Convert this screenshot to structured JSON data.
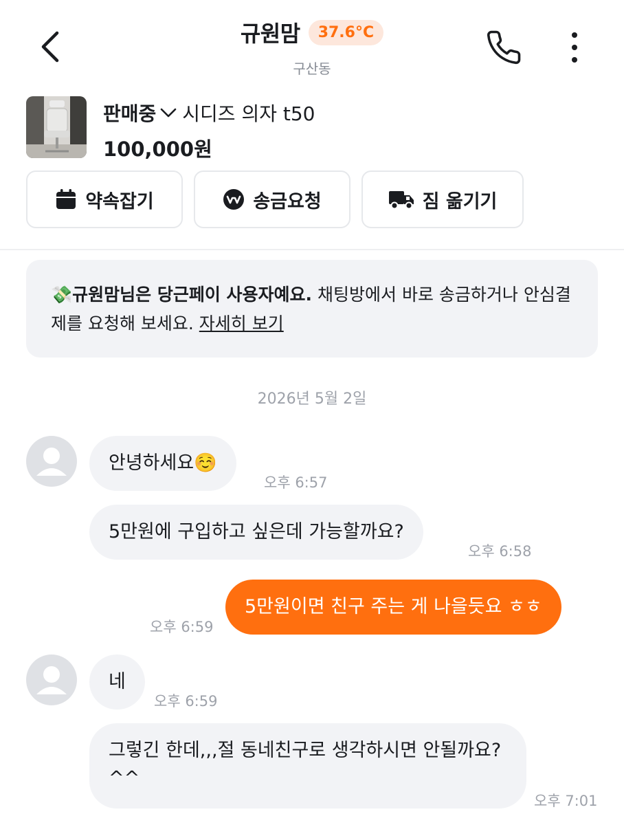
{
  "header": {
    "title": "규원맘",
    "temperature": "37.6°C",
    "location": "구산동",
    "back_icon": "chevron-left-icon",
    "call_icon": "phone-icon",
    "more_icon": "more-vertical-icon"
  },
  "product": {
    "status": "판매중",
    "name": "시디즈 의자 t50",
    "price": "100,000원"
  },
  "actions": [
    {
      "label": "약속잡기",
      "icon": "calendar-icon"
    },
    {
      "label": "송금요청",
      "icon": "won-coin-icon"
    },
    {
      "label": "짐 옮기기",
      "icon": "truck-icon"
    }
  ],
  "notice": {
    "emoji": "💸",
    "bold_text": "규원맘님은 당근페이 사용자예요.",
    "text": " 채팅방에서 바로 송금하거나 안심결제를 요청해 보세요. ",
    "link": "자세히 보기"
  },
  "date_separator": "2026년 5월 2일",
  "messages": [
    {
      "sender": "other",
      "text": "안녕하세요☺️",
      "time": "오후 6:57"
    },
    {
      "sender": "other",
      "text": "5만원에 구입하고 싶은데 가능할까요?",
      "time": "오후 6:58"
    },
    {
      "sender": "me",
      "text": "5만원이면 친구 주는 게 나을듯요 ㅎㅎ",
      "time": "오후 6:59"
    },
    {
      "sender": "other",
      "text": "네",
      "time": "오후 6:59"
    },
    {
      "sender": "other",
      "text": "그렇긴 한데,,,절 동네친구로 생각하시면 안될까요?^^",
      "time": "오후 7:01"
    }
  ],
  "colors": {
    "accent": "#ff6f0f",
    "bubble_other": "#f2f3f6",
    "muted_text": "#9ea2aa"
  }
}
